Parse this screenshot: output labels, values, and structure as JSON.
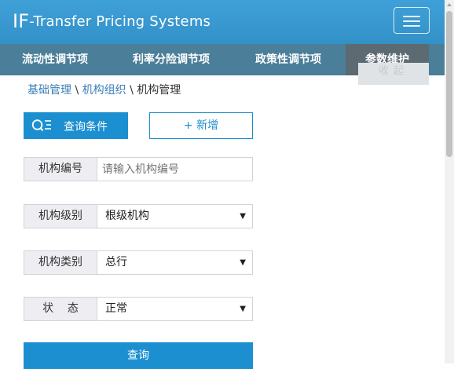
{
  "header": {
    "brand_big": "IF",
    "brand_rest": "-Transfer Pricing Systems",
    "menu_toggle_icon": "hamburger-icon"
  },
  "nav": {
    "items": [
      {
        "label": "流动性调节项"
      },
      {
        "label": "利率分险调节项"
      },
      {
        "label": "政策性调节项"
      },
      {
        "label": "参数维护",
        "active": true
      }
    ],
    "collapse_label": "收起"
  },
  "breadcrumb": {
    "items": [
      "基础管理",
      "机构组织",
      "机构管理"
    ],
    "separator": "\\"
  },
  "toolbar": {
    "query_conditions_label": "查询条件",
    "query_conditions_icon": "search-list-icon",
    "add_label": "+ 新增"
  },
  "form": {
    "org_code": {
      "label": "机构编号",
      "placeholder": "请输入机构编号",
      "value": ""
    },
    "org_level": {
      "label": "机构级别",
      "value": "根级机构"
    },
    "org_type": {
      "label": "机构类别",
      "value": "总行"
    },
    "status": {
      "label": "状    态",
      "value": "正常"
    },
    "submit_label": "查询"
  },
  "colors": {
    "header": "#3b99d0",
    "navbar": "#4a7e99",
    "nav_active": "#5c6a72",
    "primary": "#1c8fd0"
  }
}
